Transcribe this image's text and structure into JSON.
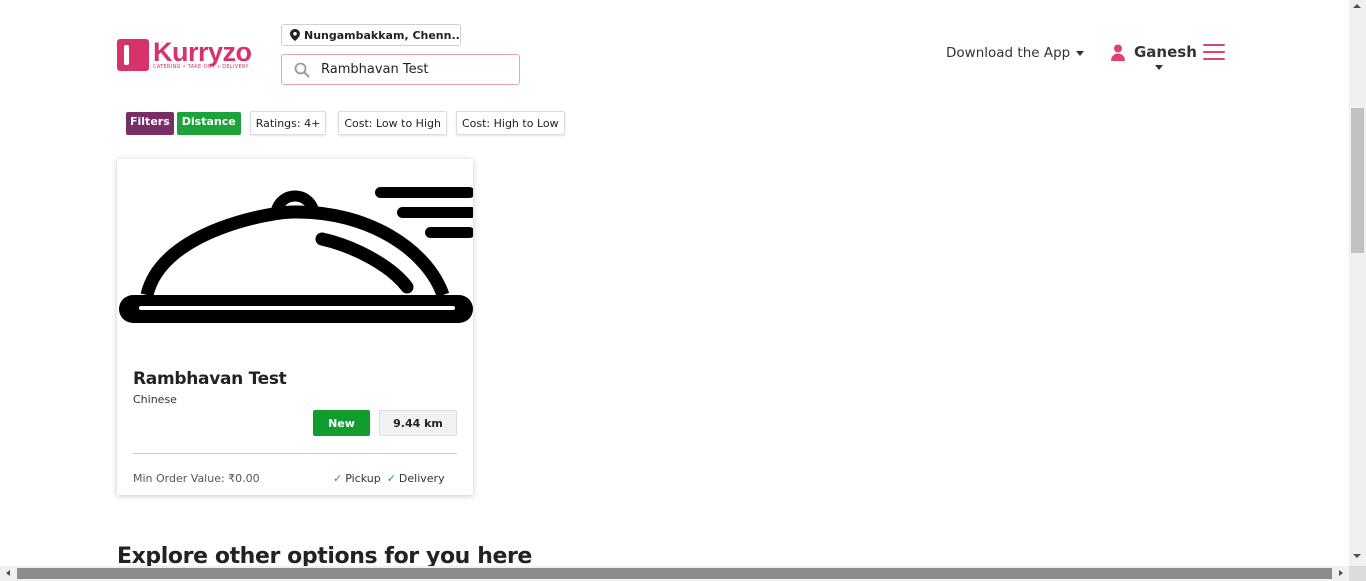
{
  "brand": {
    "name": "Kurryzo",
    "tagline": "CATERING • TAKE-OUT • DELIVERY",
    "color": "#d6336c"
  },
  "header": {
    "location": "Nungambakkam, Chenn...",
    "search": {
      "value": "Rambhavan Test",
      "placeholder": ""
    },
    "download_app": "Download the App",
    "user_name": "Ganesh",
    "icons": [
      "map-pin-icon",
      "search-icon",
      "user-icon",
      "hamburger-menu-icon"
    ]
  },
  "filters": {
    "filters_label": "Filters",
    "distance_label": "Distance",
    "ratings_label": "Ratings: 4+",
    "cost_low_high": "Cost: Low to High",
    "cost_high_low": "Cost: High to Low",
    "colors": {
      "filters": "#7a2e66",
      "distance": "#1ea23c"
    }
  },
  "results": [
    {
      "name": "Rambhavan Test",
      "cuisine": "Chinese",
      "badge": "New",
      "distance": "9.44 km",
      "min_order": "Min Order Value: ₹0.00",
      "services": [
        "Pickup",
        "Delivery"
      ],
      "check_glyph": "✓",
      "image_icon": "food-cloche-icon"
    }
  ],
  "explore_heading": "Explore other options for you here"
}
